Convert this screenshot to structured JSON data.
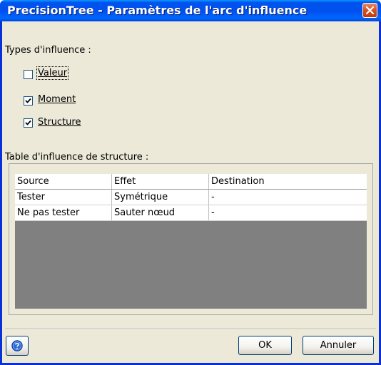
{
  "window": {
    "title": "PrecisionTree - Paramètres de l'arc d'influence"
  },
  "influence_types": {
    "label": "Types d'influence :",
    "options": [
      {
        "label": "Valeur",
        "checked": false
      },
      {
        "label": "Moment",
        "checked": true
      },
      {
        "label": "Structure",
        "checked": true
      }
    ]
  },
  "structure_table": {
    "label": "Table d'influence de structure :",
    "columns": [
      "Source",
      "Effet",
      "Destination"
    ],
    "rows": [
      [
        "Tester",
        "Symétrique",
        "-"
      ],
      [
        "Ne pas tester",
        "Sauter nœud",
        "-"
      ]
    ]
  },
  "buttons": {
    "ok": "OK",
    "cancel": "Annuler"
  },
  "icons": {
    "close": "close-icon",
    "help": "help-icon",
    "check": "checkmark-icon"
  }
}
